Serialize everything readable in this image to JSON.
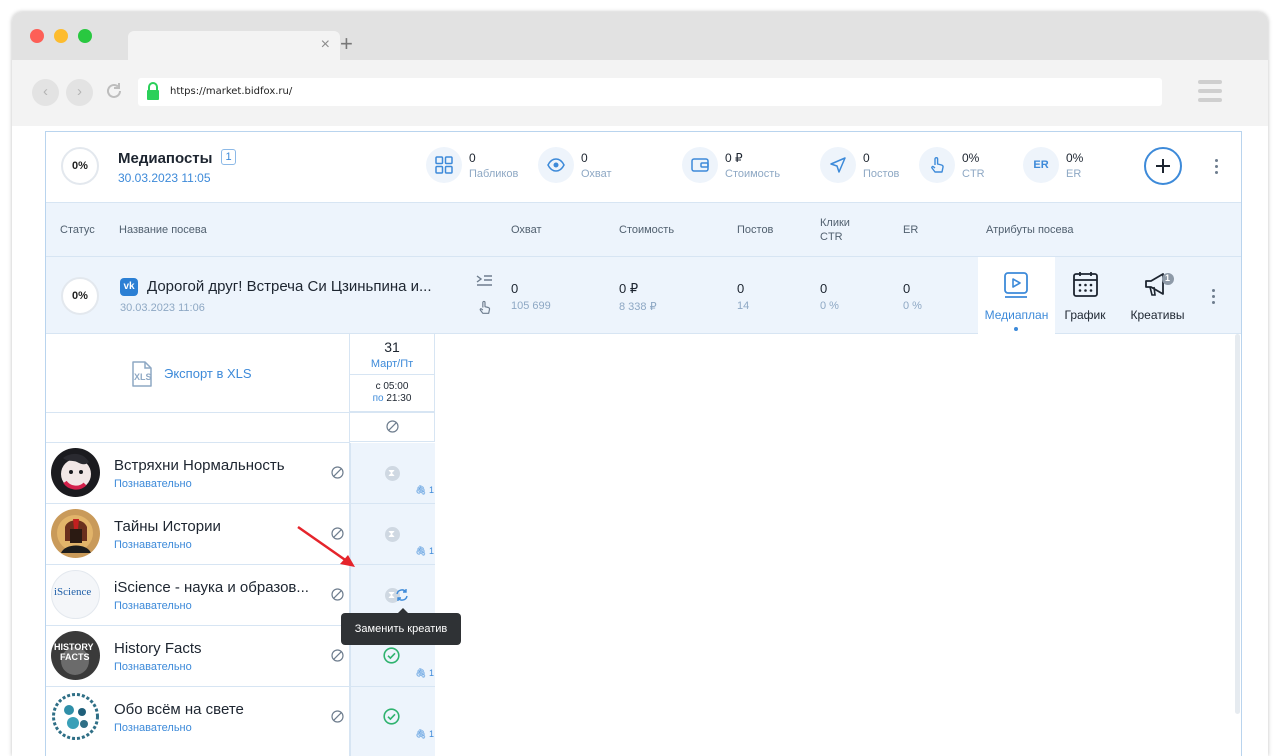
{
  "browser": {
    "url": "https://market.bidfox.ru/",
    "tab_close": "×",
    "tab_new": "+",
    "back": "‹",
    "forward": "›"
  },
  "header": {
    "progress": "0%",
    "title": "Медиапосты",
    "badge": "1",
    "date": "30.03.2023 11:05",
    "stats": [
      {
        "value": "0",
        "label": "Пабликов",
        "icon": "grid-icon"
      },
      {
        "value": "0",
        "label": "Охват",
        "icon": "eye-icon"
      },
      {
        "value": "0 ₽",
        "label": "Стоимость",
        "icon": "wallet-icon"
      },
      {
        "value": "0",
        "label": "Постов",
        "icon": "send-icon"
      },
      {
        "value": "0%",
        "label": "CTR",
        "icon": "pointer-icon"
      },
      {
        "value": "0%",
        "label": "ER",
        "icon": "er-icon",
        "icon_text": "ER"
      }
    ]
  },
  "columns": {
    "status": "Статус",
    "name": "Название посева",
    "reach": "Охват",
    "cost": "Стоимость",
    "posts": "Постов",
    "clicks": "Клики",
    "ctr": "CTR",
    "er": "ER",
    "attrs": "Атрибуты посева"
  },
  "campaign": {
    "progress": "0%",
    "vk": "vk",
    "title": "Дорогой друг! Встреча Си Цзиньпина и...",
    "date": "30.03.2023 11:06",
    "reach": "0",
    "reach_sub": "105 699",
    "cost": "0 ₽",
    "cost_sub": "8 338 ₽",
    "posts": "0",
    "posts_sub": "14",
    "ctr": "0",
    "ctr_sub": "0 %",
    "er": "0",
    "er_sub": "0 %",
    "tabs": [
      "Медиаплан",
      "График",
      "Креативы"
    ],
    "creatives_count": "1"
  },
  "mediaplan": {
    "export": "Экспорт в XLS",
    "xls_icon_text": "XLS",
    "day": "31",
    "month": "Март/Пт",
    "from_prefix": "с",
    "from": "05:00",
    "to_prefix": "по",
    "to": "21:30",
    "channels": [
      {
        "name": "Встряхни Нормальность",
        "category": "Познавательно",
        "status": "pending",
        "clips": "1"
      },
      {
        "name": "Тайны Истории",
        "category": "Познавательно",
        "status": "pending",
        "clips": "1"
      },
      {
        "name": "iScience - наука и образов...",
        "category": "Познавательно",
        "status": "pending",
        "clips": ""
      },
      {
        "name": "History Facts",
        "category": "Познавательно",
        "status": "done",
        "clips": "1"
      },
      {
        "name": "Обо всём на свете",
        "category": "Познавательно",
        "status": "done",
        "clips": "1"
      }
    ],
    "avatar_texts": {
      "iscience": "iScience",
      "history_1": "HISTORY",
      "history_2": "FACTS"
    },
    "tooltip": "Заменить креатив"
  },
  "colors": {
    "accent": "#3d8ad9",
    "row_bg": "#edf4fc",
    "success": "#2fb36f",
    "arrow": "#e5242b"
  }
}
